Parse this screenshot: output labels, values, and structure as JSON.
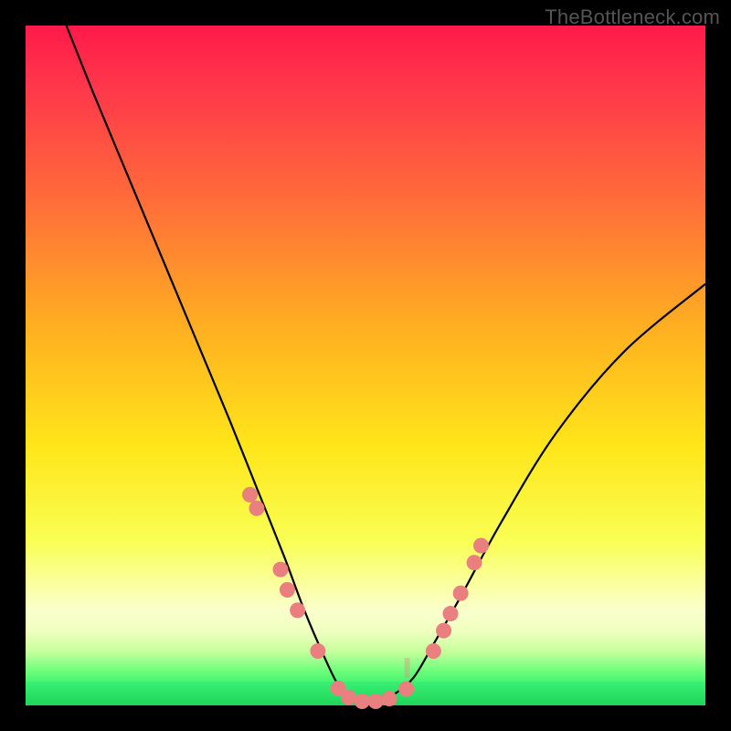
{
  "watermark": "TheBottleneck.com",
  "chart_data": {
    "type": "line",
    "title": "",
    "xlabel": "",
    "ylabel": "",
    "xlim": [
      0,
      100
    ],
    "ylim": [
      0,
      100
    ],
    "grid": false,
    "legend": false,
    "series": [
      {
        "name": "curve",
        "x": [
          6,
          10,
          15,
          20,
          25,
          30,
          34,
          38,
          41,
          44,
          46,
          48,
          50,
          52,
          54,
          57,
          60,
          64,
          70,
          78,
          88,
          100
        ],
        "y": [
          100,
          90,
          78,
          66,
          54,
          42,
          32,
          22,
          14,
          7,
          3,
          1,
          0,
          0.5,
          1.5,
          4,
          9,
          16,
          27,
          40,
          52,
          62
        ]
      }
    ],
    "markers": [
      {
        "x": 33,
        "y": 31
      },
      {
        "x": 34,
        "y": 29
      },
      {
        "x": 37.5,
        "y": 20
      },
      {
        "x": 38.5,
        "y": 17
      },
      {
        "x": 40,
        "y": 14
      },
      {
        "x": 43,
        "y": 8
      },
      {
        "x": 46,
        "y": 2.5
      },
      {
        "x": 47.5,
        "y": 1.2
      },
      {
        "x": 49.5,
        "y": 0.6
      },
      {
        "x": 51.5,
        "y": 0.6
      },
      {
        "x": 53.5,
        "y": 1.0
      },
      {
        "x": 56,
        "y": 2.4
      },
      {
        "x": 60,
        "y": 8
      },
      {
        "x": 61.5,
        "y": 11
      },
      {
        "x": 62.5,
        "y": 13.5
      },
      {
        "x": 64,
        "y": 16.5
      },
      {
        "x": 66,
        "y": 21
      },
      {
        "x": 67,
        "y": 23.5
      }
    ]
  }
}
